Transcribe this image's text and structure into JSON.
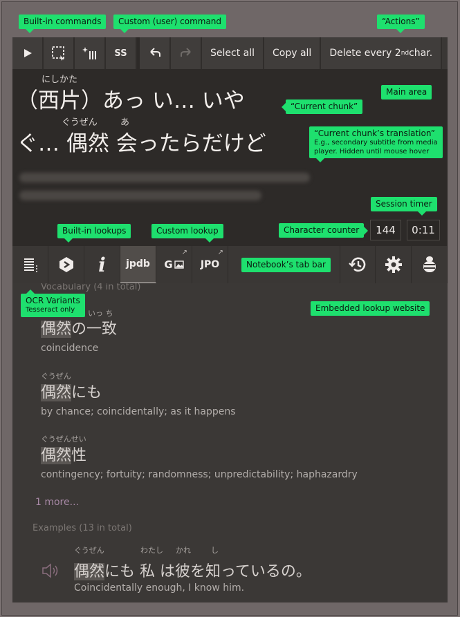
{
  "toolbar": {
    "buttons": [
      {
        "name": "play-icon"
      },
      {
        "name": "select-region-icon"
      },
      {
        "name": "magic-wand-icon"
      },
      {
        "label": "SS"
      },
      {
        "name": "undo-icon"
      },
      {
        "name": "redo-icon"
      }
    ],
    "select_all": "Select all",
    "copy_all": "Copy all",
    "delete_every_prefix": "Delete every 2",
    "delete_every_sup": "nd",
    "delete_every_suffix": " char.",
    "ss_label": "SS"
  },
  "main": {
    "line1": "（西片）あっ い… いや",
    "line1_ruby": "にしかた",
    "line2": "ぐ… 偶然 会ったらだけど",
    "line2_ruby1": "ぐうぜん",
    "line2_ruby2": "あ"
  },
  "counters": {
    "characters": "144",
    "timer": "0:11"
  },
  "tabs": {
    "jpdb": "jpdb",
    "google_lens": "G",
    "jpo": "JPO"
  },
  "lookup": {
    "entries": [
      {
        "ruby_a": "ぐうぜん",
        "ruby_b": "いっ ち",
        "word_hl": "偶然",
        "word_rest": "の一致",
        "def": "coincidence"
      },
      {
        "ruby_a": "ぐうぜん",
        "ruby_b": "",
        "word_hl": "偶然",
        "word_rest": "にも",
        "def": "by chance; coincidentally; as it happens"
      },
      {
        "ruby_a": "ぐうぜんせい",
        "ruby_b": "",
        "word_hl": "偶然",
        "word_rest": "性",
        "def": "contingency; fortuity; randomness; unpredictability; haphazardry"
      }
    ],
    "top_cut": "Vocabulary (4 in total)",
    "more": "1 more...",
    "examples_header": "Examples (13 in total)",
    "example_ruby1": "ぐうぜん",
    "example_ruby2": "わたし",
    "example_ruby3": "かれ",
    "example_ruby4": "し",
    "example_hl": "偶然",
    "example_rest": "にも 私 は彼を知っているの。",
    "example_translation": "Coincidentally enough, I know him."
  },
  "notes": {
    "builtin_commands": "Built-in commands",
    "custom_command": "Custom (user) command",
    "actions": "“Actions”",
    "main_area": "Main area",
    "current_chunk": "“Current chunk”",
    "translation_title": "“Current chunk’s translation”",
    "translation_sub1": "E.g., secondary subtitle from media",
    "translation_sub2": "player. Hidden until mouse hover",
    "session_timer": "Session timer",
    "character_counter": "Character counter",
    "builtin_lookups": "Built-in lookups",
    "custom_lookup": "Custom lookup",
    "notebook_tab_bar": "Notebook’s tab bar",
    "ocr_variants": "OCR Variants",
    "ocr_sub": "Tesseract only",
    "embedded_lookup": "Embedded lookup website"
  },
  "colors": {
    "accent_note": "#1ee06e",
    "app_bg": "#2d2a28",
    "toolbar_bg": "#403d3b",
    "highlight": "#5a5653",
    "more_link": "#a889a6"
  }
}
